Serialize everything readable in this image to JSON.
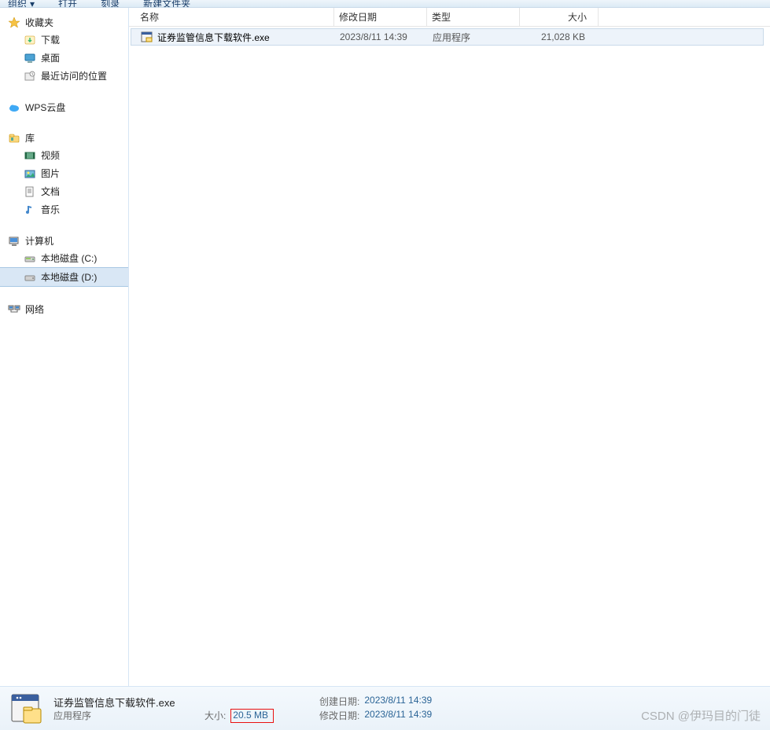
{
  "toolbar": {
    "organize": "组织",
    "open": "打开",
    "burn": "刻录",
    "new_folder": "新建文件夹"
  },
  "sidebar": {
    "favorites": {
      "label": "收藏夹",
      "items": [
        {
          "label": "下载"
        },
        {
          "label": "桌面"
        },
        {
          "label": "最近访问的位置"
        }
      ]
    },
    "wps": {
      "label": "WPS云盘"
    },
    "libraries": {
      "label": "库",
      "items": [
        {
          "label": "视频"
        },
        {
          "label": "图片"
        },
        {
          "label": "文档"
        },
        {
          "label": "音乐"
        }
      ]
    },
    "computer": {
      "label": "计算机",
      "items": [
        {
          "label": "本地磁盘 (C:)"
        },
        {
          "label": "本地磁盘 (D:)"
        }
      ]
    },
    "network": {
      "label": "网络"
    }
  },
  "columns": {
    "name": "名称",
    "date": "修改日期",
    "type": "类型",
    "size": "大小"
  },
  "files": [
    {
      "name": "证券监管信息下载软件.exe",
      "date": "2023/8/11 14:39",
      "type": "应用程序",
      "size": "21,028 KB"
    }
  ],
  "details": {
    "filename": "证券监管信息下载软件.exe",
    "filetype": "应用程序",
    "modified_label": "修改日期:",
    "modified": "2023/8/11 14:39",
    "created_label": "创建日期:",
    "created": "2023/8/11 14:39",
    "size_label": "大小:",
    "size": "20.5 MB"
  },
  "watermark": "CSDN @伊玛目的门徒"
}
